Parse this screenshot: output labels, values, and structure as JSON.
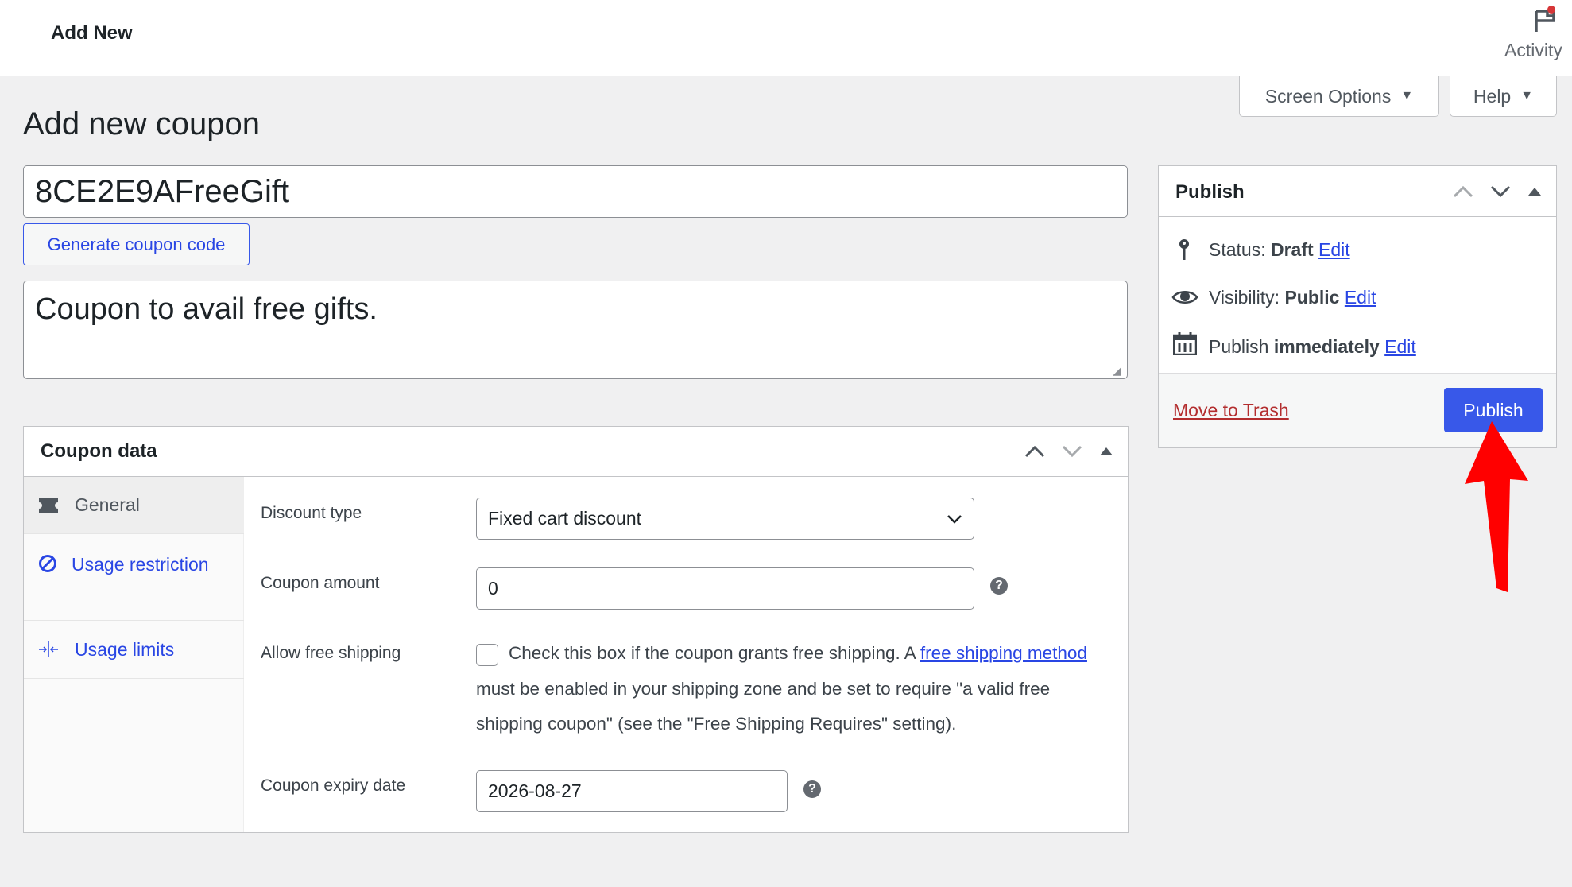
{
  "topbar": {
    "title": "Add New",
    "activity_label": "Activity"
  },
  "screen_options": {
    "screen_options_label": "Screen Options",
    "help_label": "Help"
  },
  "page_title": "Add new coupon",
  "coupon_code": "8CE2E9AFreeGift",
  "generate_label": "Generate coupon code",
  "description": "Coupon to avail free gifts.",
  "coupon_data": {
    "title": "Coupon data",
    "tabs": [
      {
        "label": "General",
        "icon": "ticket-icon"
      },
      {
        "label": "Usage restriction",
        "icon": "no-icon"
      },
      {
        "label": "Usage limits",
        "icon": "arrows-in-icon"
      }
    ],
    "discount_type": {
      "label": "Discount type",
      "value": "Fixed cart discount"
    },
    "coupon_amount": {
      "label": "Coupon amount",
      "value": "0"
    },
    "free_shipping": {
      "label": "Allow free shipping",
      "checked": false,
      "text_before": "Check this box if the coupon grants free shipping. A ",
      "link": "free shipping method",
      "text_after": " must be enabled in your shipping zone and be set to require \"a valid free shipping coupon\" (see the \"Free Shipping Requires\" setting)."
    },
    "expiry": {
      "label": "Coupon expiry date",
      "value": "2026-08-27"
    }
  },
  "publish": {
    "title": "Publish",
    "status_label": "Status: ",
    "status_value": "Draft",
    "visibility_label": "Visibility: ",
    "visibility_value": "Public",
    "schedule_label": "Publish ",
    "schedule_value": "immediately",
    "edit": "Edit",
    "trash": "Move to Trash",
    "publish_button": "Publish"
  },
  "colors": {
    "accent": "#3858e9",
    "trash": "#b32d2e",
    "annotation_arrow": "#ff0000"
  }
}
